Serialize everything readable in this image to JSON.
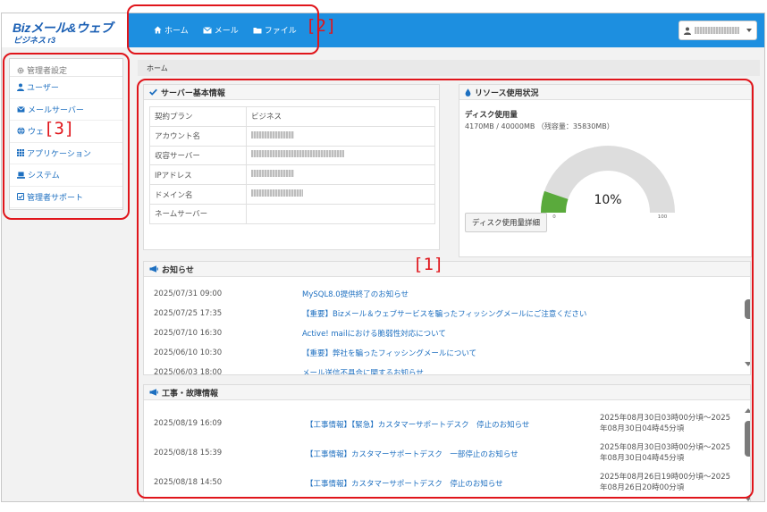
{
  "logo": {
    "main": "Bizメール&ウェブ",
    "sub": "ビジネス r3"
  },
  "nav": [
    {
      "label": "ホーム",
      "icon": "home-icon"
    },
    {
      "label": "メール",
      "icon": "envelope-icon"
    },
    {
      "label": "ファイル",
      "icon": "folder-icon"
    }
  ],
  "sidebar": {
    "header": "管理者設定",
    "items": [
      {
        "label": "ユーザー",
        "icon": "user-icon"
      },
      {
        "label": "メールサーバー",
        "icon": "envelope-icon"
      },
      {
        "label": "ウェ",
        "icon": "globe-icon"
      },
      {
        "label": "アプリケーション",
        "icon": "grid-icon"
      },
      {
        "label": "システム",
        "icon": "server-icon"
      },
      {
        "label": "管理者サポート",
        "icon": "support-icon"
      }
    ]
  },
  "breadcrumb": "ホーム",
  "server_panel": {
    "title": "サーバー基本情報",
    "rows": [
      {
        "key": "契約プラン",
        "value": "ビジネス"
      },
      {
        "key": "アカウント名",
        "value": ""
      },
      {
        "key": "収容サーバー",
        "value": ""
      },
      {
        "key": "IPアドレス",
        "value": ""
      },
      {
        "key": "ドメイン名",
        "value": ""
      },
      {
        "key": "ネームサーバー",
        "value": ""
      }
    ]
  },
  "resource_panel": {
    "title": "リソース使用状況",
    "disk_title": "ディスク使用量",
    "disk_usage": "4170MB / 40000MB （残容量：35830MB）",
    "gauge": {
      "percent_label": "10%",
      "fraction": 0.104,
      "min_label": "0",
      "max_label": "100",
      "fill_color": "#5aaa3c",
      "track_color": "#dddddd"
    },
    "detail_button": "ディスク使用量詳細"
  },
  "news_panel": {
    "title": "お知らせ",
    "items": [
      {
        "date": "2025/07/31 09:00",
        "text": "MySQL8.0提供終了のお知らせ"
      },
      {
        "date": "2025/07/25 17:35",
        "text": "【重要】Bizメール＆ウェブサービスを騙ったフィッシングメールにご注意ください"
      },
      {
        "date": "2025/07/10 16:30",
        "text": "Active! mailにおける脆弱性対応について"
      },
      {
        "date": "2025/06/10 10:30",
        "text": "【重要】弊社を騙ったフィッシングメールについて"
      },
      {
        "date": "2025/06/03 18:00",
        "text": "メール送信不具合に関するお知らせ"
      }
    ]
  },
  "works_panel": {
    "title": "工事・故障情報",
    "items": [
      {
        "date": "2025/08/19 16:09",
        "text": "【工事情報】【緊急】カスタマーサポートデスク　停止のお知らせ",
        "period": "2025年08月30日03時00分頃～2025年08月30日04時45分頃"
      },
      {
        "date": "2025/08/18 15:39",
        "text": "【工事情報】カスタマーサポートデスク　一部停止のお知らせ",
        "period": "2025年08月30日03時00分頃～2025年08月30日04時45分頃"
      },
      {
        "date": "2025/08/18 14:50",
        "text": "【工事情報】カスタマーサポートデスク　停止のお知らせ",
        "period": "2025年08月26日19時00分頃～2025年08月26日20時00分頃"
      }
    ]
  },
  "annotations": [
    "[1]",
    "[2]",
    "[3]"
  ],
  "colors": {
    "brand_blue": "#1d8fe0",
    "link_blue": "#1d6fc0",
    "annotation_red": "#e0151b",
    "gauge_green": "#5aaa3c"
  }
}
